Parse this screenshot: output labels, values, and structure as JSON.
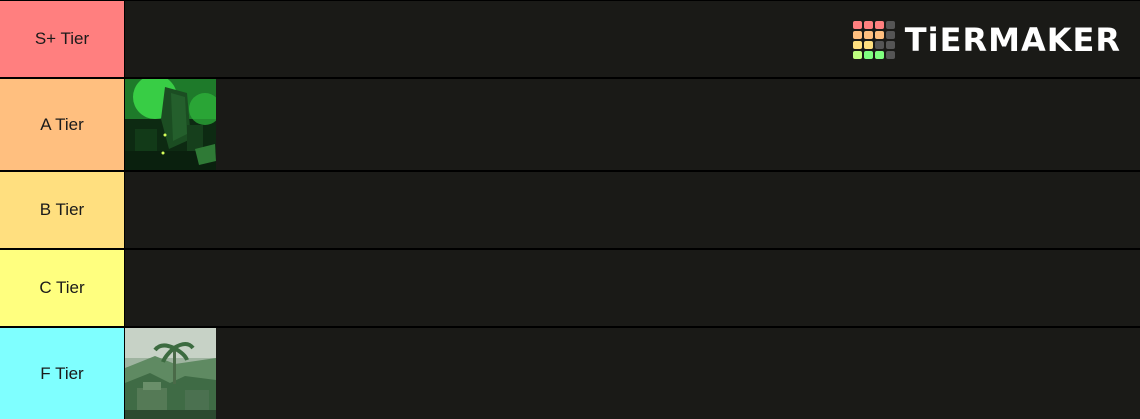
{
  "rows": [
    {
      "label": "S+ Tier",
      "color": "#ff7f7f"
    },
    {
      "label": "A Tier",
      "color": "#ffbf7f"
    },
    {
      "label": "B Tier",
      "color": "#ffdf7f"
    },
    {
      "label": "C Tier",
      "color": "#ffff7f"
    },
    {
      "label": "F Tier",
      "color": "#7fffff"
    }
  ],
  "items": {
    "a_tier": [
      {
        "icon": "green-glowing-ruins-image"
      }
    ],
    "f_tier": [
      {
        "icon": "jungle-temple-palm-image"
      }
    ]
  },
  "logo": {
    "text": "TiERMAKER",
    "icon": "tiermaker-grid-icon",
    "grid_colors": [
      "#ff7f7f",
      "#ff7f7f",
      "#ff7f7f",
      "#555555",
      "#ffbf7f",
      "#ffbf7f",
      "#ffbf7f",
      "#555555",
      "#ffdf7f",
      "#ffdf7f",
      "#555555",
      "#555555",
      "#bfff7f",
      "#7fff7f",
      "#7fff7f",
      "#555555"
    ]
  },
  "colors": {
    "row_background": "#1a1a17",
    "separator": "#000000"
  }
}
